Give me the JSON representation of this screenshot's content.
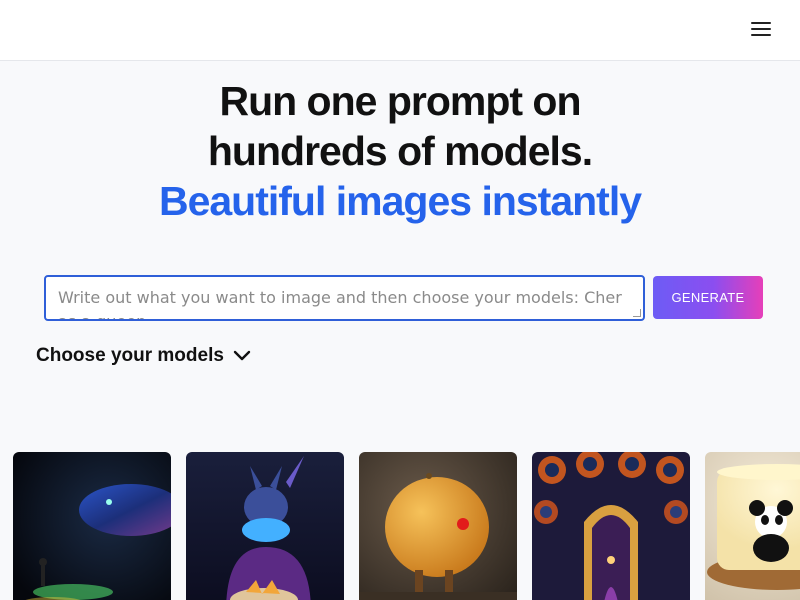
{
  "header": {
    "menu_icon": "hamburger-menu-icon"
  },
  "hero": {
    "line1": "Run one prompt on",
    "line2": "hundreds of models.",
    "line3": "Beautiful images instantly",
    "accent_color": "#2563eb"
  },
  "prompt": {
    "placeholder": "Write out what you want to image and then choose your models: Cher as a queen",
    "value": ""
  },
  "generate_button": {
    "label": "GENERATE"
  },
  "models": {
    "label": "Choose your models",
    "icon": "chevron-down-icon"
  },
  "gallery": [
    {
      "subject": "glowing fish and fisherman"
    },
    {
      "subject": "horned creature with chips bowl"
    },
    {
      "subject": "orange with red nose"
    },
    {
      "subject": "ornate symmetrical hall"
    },
    {
      "subject": "panda candle"
    }
  ]
}
